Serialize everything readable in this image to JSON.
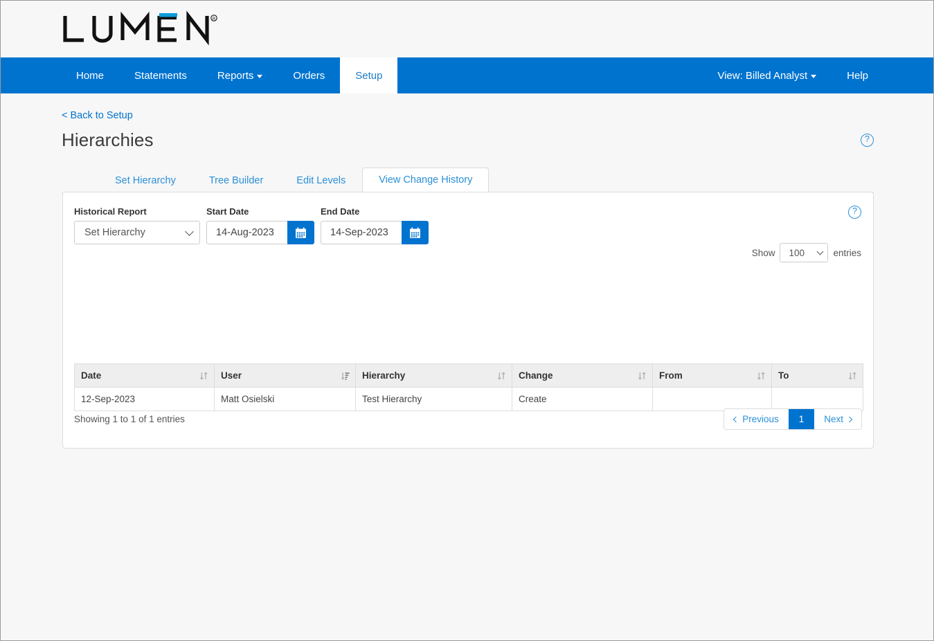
{
  "brand": {
    "name": "LUMEN",
    "registered_mark": "®",
    "accent_color": "#0d9ddb",
    "nav_color": "#0073cf"
  },
  "nav": {
    "left_items": [
      {
        "label": "Home",
        "active": false,
        "has_caret": false
      },
      {
        "label": "Statements",
        "active": false,
        "has_caret": false
      },
      {
        "label": "Reports",
        "active": false,
        "has_caret": true
      },
      {
        "label": "Orders",
        "active": false,
        "has_caret": false
      },
      {
        "label": "Setup",
        "active": true,
        "has_caret": false
      }
    ],
    "right_items": [
      {
        "label": "View: Billed Analyst",
        "active": false,
        "has_caret": true
      },
      {
        "label": "Help",
        "active": false,
        "has_caret": false
      }
    ]
  },
  "back_link": "< Back to Setup",
  "page_title": "Hierarchies",
  "help_icon": "?",
  "subtabs": [
    {
      "label": "Set Hierarchy",
      "active": false
    },
    {
      "label": "Tree Builder",
      "active": false
    },
    {
      "label": "Edit Levels",
      "active": false
    },
    {
      "label": "View Change History",
      "active": true
    }
  ],
  "filters": {
    "historical_report": {
      "label": "Historical Report",
      "value": "Set Hierarchy"
    },
    "start_date": {
      "label": "Start Date",
      "value": "14-Aug-2023",
      "placeholder": ""
    },
    "end_date": {
      "label": "End Date",
      "value": "14-Sep-2023",
      "placeholder": ""
    }
  },
  "show_entries": {
    "prefix": "Show",
    "value": "100",
    "suffix": "entries"
  },
  "table": {
    "columns": [
      {
        "label": "Date",
        "sort": "none"
      },
      {
        "label": "User",
        "sort": "desc"
      },
      {
        "label": "Hierarchy",
        "sort": "none"
      },
      {
        "label": "Change",
        "sort": "none"
      },
      {
        "label": "From",
        "sort": "none"
      },
      {
        "label": "To",
        "sort": "none"
      }
    ],
    "rows": [
      {
        "date": "12-Sep-2023",
        "user": "Matt Osielski",
        "hierarchy": "Test Hierarchy",
        "change": "Create",
        "from": "",
        "to": ""
      }
    ]
  },
  "footer": {
    "showing_info": "Showing 1 to 1 of 1 entries",
    "pagination": {
      "previous": "Previous",
      "current_page": "1",
      "next": "Next"
    }
  }
}
